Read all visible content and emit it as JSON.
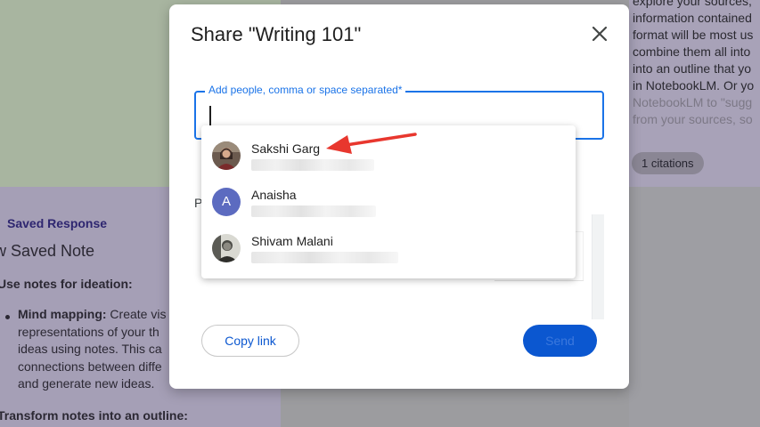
{
  "background": {
    "right_text_lines": [
      "explore your sources,",
      "information contained",
      "format will be most us",
      "combine them all into",
      "into an outline that yo",
      "in NotebookLM. Or yo",
      "NotebookLM to \"sugg",
      "from your sources, so"
    ],
    "citations_chip": "1 citations",
    "saved_response_label": "Saved Response",
    "saved_note_title": "w Saved Note",
    "heading_ideation": "Use notes for ideation:",
    "bullet_bold": "Mind mapping:",
    "bullet_lines": [
      " Create vis",
      "representations of your th",
      "ideas using notes. This ca",
      "connections between diffe",
      "and generate new ideas."
    ],
    "heading_outline": "Transform notes into an outline:"
  },
  "dialog": {
    "title": "Share \"Writing 101\"",
    "field_label": "Add people, comma or space separated*",
    "field_value": "",
    "partial_label": "P",
    "copy_link_label": "Copy link",
    "send_label": "Send"
  },
  "suggestions": [
    {
      "name": "Sakshi Garg",
      "avatar": "photo"
    },
    {
      "name": "Anaisha",
      "avatar": "letter",
      "initial": "A",
      "color": "#5c6bc0"
    },
    {
      "name": "Shivam Malani",
      "avatar": "photo"
    }
  ],
  "colors": {
    "accent": "#1a73e8",
    "button": "#0b57d0",
    "annotation_arrow": "#e8372e"
  }
}
